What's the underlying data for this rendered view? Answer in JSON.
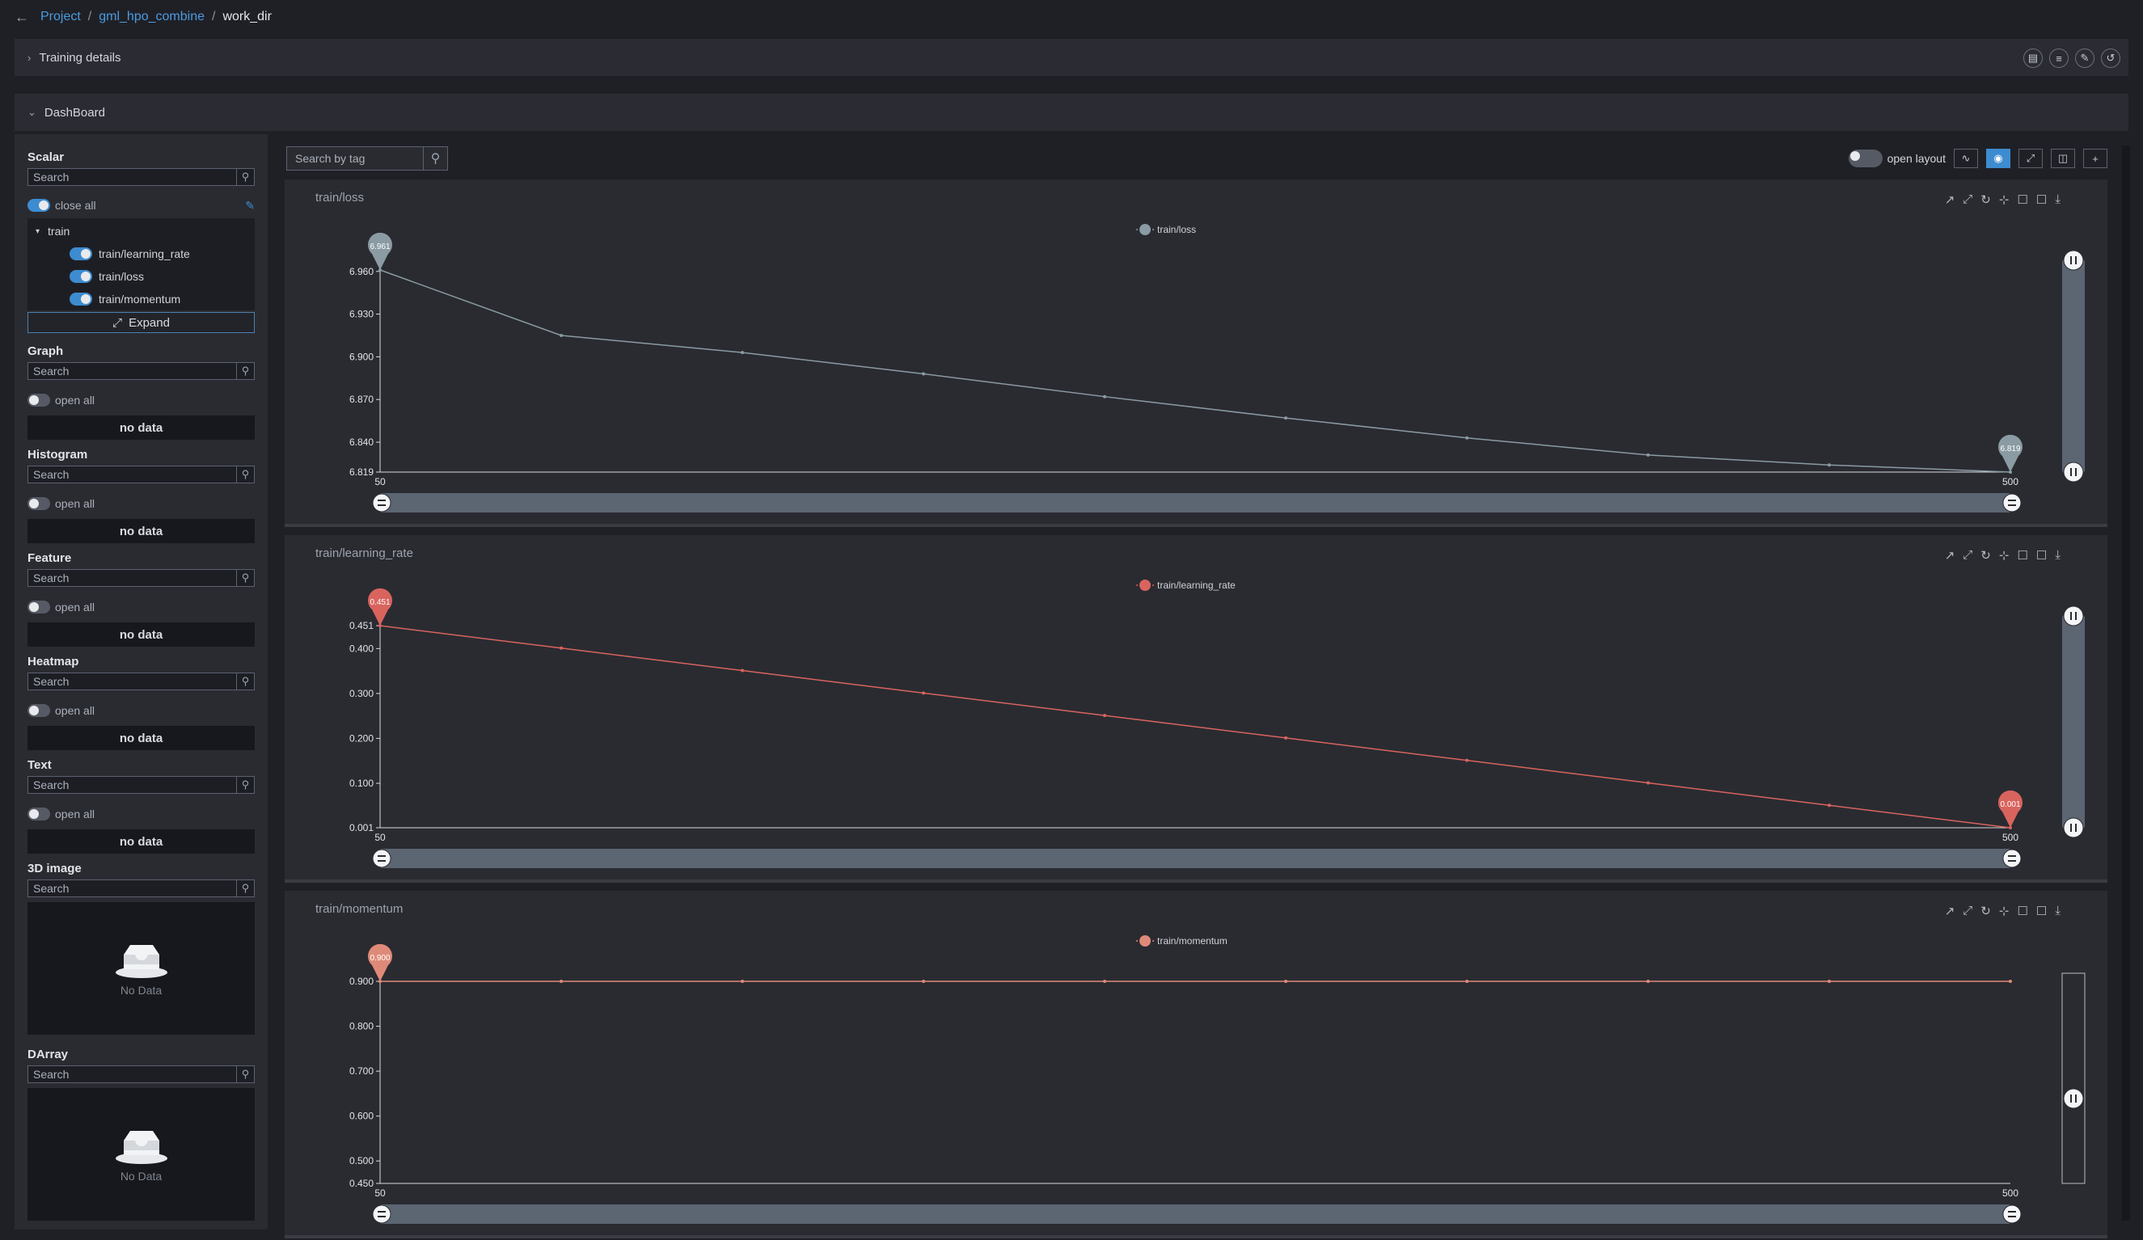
{
  "breadcrumb": {
    "back": "←",
    "project": "Project",
    "combine": "gml_hpo_combine",
    "current": "work_dir",
    "sep": "/"
  },
  "sections": {
    "training_details": "Training details",
    "dashboard": "DashBoard",
    "icons": [
      "document-icon",
      "layers-icon",
      "edit-icon",
      "share-icon"
    ]
  },
  "sidebar": {
    "search_placeholder": "Search",
    "close_all": "close all",
    "open_all": "open all",
    "no_data": "no data",
    "no_data_box": "No Data",
    "expand": "Expand",
    "scalar": {
      "title": "Scalar",
      "tree_group": "train",
      "items": [
        "train/learning_rate",
        "train/loss",
        "train/momentum"
      ]
    },
    "graph": "Graph",
    "histogram": "Histogram",
    "feature": "Feature",
    "heatmap": "Heatmap",
    "text": "Text",
    "image3d": "3D image",
    "darray": "DArray"
  },
  "toolbar": {
    "search_placeholder": "Search by tag",
    "open_layout": "open layout"
  },
  "colors": {
    "loss": "#8a9ba3",
    "lr": "#d9645e",
    "momentum": "#df8a78",
    "accent": "#3d8cd0"
  },
  "chart_data": [
    {
      "type": "line",
      "title": "train/loss",
      "series": [
        {
          "name": "train/loss",
          "x": [
            50,
            100,
            150,
            200,
            250,
            300,
            350,
            400,
            450,
            500
          ],
          "values": [
            6.961,
            6.915,
            6.903,
            6.888,
            6.872,
            6.857,
            6.843,
            6.831,
            6.824,
            6.819
          ]
        }
      ],
      "yticks": [
        "6.960",
        "6.930",
        "6.900",
        "6.870",
        "6.840",
        "6.819"
      ],
      "ytick_values": [
        6.96,
        6.93,
        6.9,
        6.87,
        6.84,
        6.819
      ],
      "ylim": [
        6.819,
        6.961
      ],
      "xticks": [
        "50",
        "500"
      ],
      "markers": [
        {
          "x": 50,
          "label": "6.961"
        },
        {
          "x": 500,
          "label": "6.819"
        }
      ]
    },
    {
      "type": "line",
      "title": "train/learning_rate",
      "series": [
        {
          "name": "train/learning_rate",
          "x": [
            50,
            100,
            150,
            200,
            250,
            300,
            350,
            400,
            450,
            500
          ],
          "values": [
            0.451,
            0.401,
            0.351,
            0.301,
            0.251,
            0.201,
            0.151,
            0.101,
            0.051,
            0.001
          ]
        }
      ],
      "yticks": [
        "0.451",
        "0.400",
        "0.300",
        "0.200",
        "0.100",
        "0.001"
      ],
      "ytick_values": [
        0.451,
        0.4,
        0.3,
        0.2,
        0.1,
        0.001
      ],
      "ylim": [
        0.001,
        0.451
      ],
      "xticks": [
        "50",
        "500"
      ],
      "markers": [
        {
          "x": 50,
          "label": "0.451"
        },
        {
          "x": 500,
          "label": "0.001"
        }
      ]
    },
    {
      "type": "line",
      "title": "train/momentum",
      "series": [
        {
          "name": "train/momentum",
          "x": [
            50,
            100,
            150,
            200,
            250,
            300,
            350,
            400,
            450,
            500
          ],
          "values": [
            0.9,
            0.9,
            0.9,
            0.9,
            0.9,
            0.9,
            0.9,
            0.9,
            0.9,
            0.9
          ]
        }
      ],
      "yticks": [
        "0.900",
        "0.800",
        "0.700",
        "0.600",
        "0.500",
        "0.450"
      ],
      "ytick_values": [
        0.9,
        0.8,
        0.7,
        0.6,
        0.5,
        0.45
      ],
      "ylim": [
        0.45,
        0.9
      ],
      "xticks": [
        "50",
        "500"
      ],
      "markers": [
        {
          "x": 50,
          "label": "0.900"
        }
      ]
    }
  ]
}
